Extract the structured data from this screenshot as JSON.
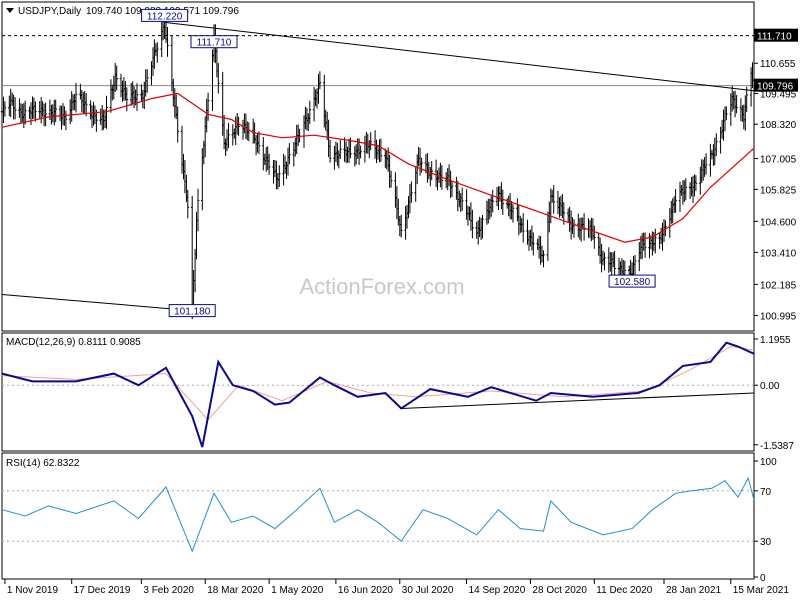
{
  "header": {
    "symbol": "USDJPY,Daily",
    "ohlc": "109.740 109.888 109.571 109.796"
  },
  "watermark": "ActionForex.com",
  "colors": {
    "candle": "#000000",
    "ma": "#e00000",
    "macd": "#0a0a8a",
    "signal": "#f0a0a0",
    "rsi": "#1e8fd8",
    "trendline": "#000000",
    "label_box": "#0a0a8a"
  },
  "x_axis": {
    "labels": [
      "1 Nov 2019",
      "17 Dec 2019",
      "3 Feb 2020",
      "18 Mar 2020",
      "1 May 2020",
      "16 Jun 2020",
      "30 Jul 2020",
      "14 Sep 2020",
      "28 Oct 2020",
      "11 Dec 2020",
      "28 Jan 2021",
      "15 Mar 2021"
    ]
  },
  "price_axis": {
    "ticks": [
      "110.655",
      "109.495",
      "108.320",
      "107.005",
      "105.825",
      "104.600",
      "103.410",
      "102.185",
      "100.995"
    ],
    "current": "109.796",
    "resistance": "111.710"
  },
  "annotations": [
    "112.220",
    "111.710",
    "101.180",
    "102.580"
  ],
  "macd_panel": {
    "title": "MACD(12,26,9) 0.8111 0.9085",
    "ticks": [
      "1.1955",
      "0.00",
      "-1.5387"
    ]
  },
  "rsi_panel": {
    "title": "RSI(14) 62.8322",
    "ticks": [
      "100",
      "70",
      "30",
      "0"
    ]
  },
  "chart_data": [
    {
      "type": "candlestick",
      "title": "USDJPY,Daily",
      "ylim": [
        100.4,
        113.0
      ],
      "x_range": [
        "2019-10-30",
        "2021-03-31"
      ],
      "price_path": [
        {
          "date": "2019-10-30",
          "value": 108.8
        },
        {
          "date": "2019-11-05",
          "value": 109.1
        },
        {
          "date": "2019-11-15",
          "value": 108.7
        },
        {
          "date": "2019-11-25",
          "value": 108.9
        },
        {
          "date": "2019-12-05",
          "value": 108.7
        },
        {
          "date": "2019-12-12",
          "value": 108.6
        },
        {
          "date": "2019-12-20",
          "value": 109.4
        },
        {
          "date": "2020-01-01",
          "value": 108.7
        },
        {
          "date": "2020-01-08",
          "value": 108.4
        },
        {
          "date": "2020-01-16",
          "value": 110.2
        },
        {
          "date": "2020-01-24",
          "value": 109.3
        },
        {
          "date": "2020-02-04",
          "value": 109.5
        },
        {
          "date": "2020-02-19",
          "value": 112.2
        },
        {
          "date": "2020-02-28",
          "value": 108.0
        },
        {
          "date": "2020-03-06",
          "value": 105.3
        },
        {
          "date": "2020-03-09",
          "value": 101.18
        },
        {
          "date": "2020-03-12",
          "value": 104.6
        },
        {
          "date": "2020-03-24",
          "value": 111.71
        },
        {
          "date": "2020-03-31",
          "value": 107.5
        },
        {
          "date": "2020-04-10",
          "value": 108.4
        },
        {
          "date": "2020-04-22",
          "value": 107.7
        },
        {
          "date": "2020-05-06",
          "value": 106.2
        },
        {
          "date": "2020-05-18",
          "value": 107.4
        },
        {
          "date": "2020-06-05",
          "value": 109.8
        },
        {
          "date": "2020-06-12",
          "value": 107.2
        },
        {
          "date": "2020-06-25",
          "value": 107.2
        },
        {
          "date": "2020-07-08",
          "value": 107.5
        },
        {
          "date": "2020-07-20",
          "value": 107.2
        },
        {
          "date": "2020-07-31",
          "value": 104.2
        },
        {
          "date": "2020-08-12",
          "value": 106.9
        },
        {
          "date": "2020-08-27",
          "value": 106.2
        },
        {
          "date": "2020-09-02",
          "value": 106.2
        },
        {
          "date": "2020-09-21",
          "value": 104.2
        },
        {
          "date": "2020-10-06",
          "value": 105.7
        },
        {
          "date": "2020-10-21",
          "value": 104.5
        },
        {
          "date": "2020-11-06",
          "value": 103.2
        },
        {
          "date": "2020-11-11",
          "value": 105.6
        },
        {
          "date": "2020-11-25",
          "value": 104.5
        },
        {
          "date": "2020-12-10",
          "value": 104.2
        },
        {
          "date": "2020-12-17",
          "value": 103.1
        },
        {
          "date": "2021-01-06",
          "value": 102.6
        },
        {
          "date": "2021-01-13",
          "value": 103.8
        },
        {
          "date": "2021-01-25",
          "value": 103.8
        },
        {
          "date": "2021-02-05",
          "value": 105.5
        },
        {
          "date": "2021-02-16",
          "value": 105.9
        },
        {
          "date": "2021-03-02",
          "value": 107.1
        },
        {
          "date": "2021-03-11",
          "value": 108.6
        },
        {
          "date": "2021-03-16",
          "value": 109.2
        },
        {
          "date": "2021-03-24",
          "value": 108.7
        },
        {
          "date": "2021-03-29",
          "value": 110.3
        },
        {
          "date": "2021-03-31",
          "value": 109.796
        }
      ],
      "moving_average": [
        {
          "date": "2019-10-30",
          "value": 108.2
        },
        {
          "date": "2019-12-01",
          "value": 108.6
        },
        {
          "date": "2020-01-10",
          "value": 108.8
        },
        {
          "date": "2020-02-10",
          "value": 109.3
        },
        {
          "date": "2020-02-28",
          "value": 109.5
        },
        {
          "date": "2020-03-20",
          "value": 108.7
        },
        {
          "date": "2020-04-05",
          "value": 108.5
        },
        {
          "date": "2020-04-20",
          "value": 108.0
        },
        {
          "date": "2020-05-10",
          "value": 107.8
        },
        {
          "date": "2020-06-01",
          "value": 107.9
        },
        {
          "date": "2020-06-25",
          "value": 107.7
        },
        {
          "date": "2020-07-15",
          "value": 107.5
        },
        {
          "date": "2020-08-05",
          "value": 106.8
        },
        {
          "date": "2020-09-01",
          "value": 106.2
        },
        {
          "date": "2020-10-01",
          "value": 105.6
        },
        {
          "date": "2020-11-01",
          "value": 105.0
        },
        {
          "date": "2020-12-01",
          "value": 104.4
        },
        {
          "date": "2021-01-01",
          "value": 103.8
        },
        {
          "date": "2021-01-20",
          "value": 104.0
        },
        {
          "date": "2021-02-10",
          "value": 104.7
        },
        {
          "date": "2021-03-01",
          "value": 105.9
        },
        {
          "date": "2021-03-31",
          "value": 107.4
        }
      ],
      "resistance_line": 111.71,
      "current_price_line": 109.796,
      "trendlines": [
        {
          "from": {
            "date": "2020-02-19",
            "value": 112.22
          },
          "to": {
            "date": "2021-03-31",
            "value": 109.6
          }
        },
        {
          "from": {
            "date": "2019-10-30",
            "value": 101.8
          },
          "to": {
            "date": "2020-03-09",
            "value": 101.18
          }
        }
      ]
    },
    {
      "type": "line",
      "title": "MACD(12,26,9) 0.8111 0.9085",
      "ylim": [
        -1.7,
        1.35
      ],
      "series": [
        {
          "name": "MACD",
          "values": [
            {
              "date": "2019-10-30",
              "value": 0.3
            },
            {
              "date": "2019-11-20",
              "value": 0.1
            },
            {
              "date": "2019-12-20",
              "value": 0.1
            },
            {
              "date": "2020-01-15",
              "value": 0.3
            },
            {
              "date": "2020-02-01",
              "value": 0.0
            },
            {
              "date": "2020-02-20",
              "value": 0.45
            },
            {
              "date": "2020-03-09",
              "value": -0.8
            },
            {
              "date": "2020-03-16",
              "value": -1.6
            },
            {
              "date": "2020-03-27",
              "value": 0.6
            },
            {
              "date": "2020-04-06",
              "value": 0.0
            },
            {
              "date": "2020-04-20",
              "value": -0.15
            },
            {
              "date": "2020-05-05",
              "value": -0.5
            },
            {
              "date": "2020-05-15",
              "value": -0.45
            },
            {
              "date": "2020-06-05",
              "value": 0.2
            },
            {
              "date": "2020-06-15",
              "value": 0.0
            },
            {
              "date": "2020-07-01",
              "value": -0.3
            },
            {
              "date": "2020-07-20",
              "value": -0.2
            },
            {
              "date": "2020-07-31",
              "value": -0.6
            },
            {
              "date": "2020-08-20",
              "value": -0.1
            },
            {
              "date": "2020-09-15",
              "value": -0.3
            },
            {
              "date": "2020-10-01",
              "value": -0.05
            },
            {
              "date": "2020-11-01",
              "value": -0.4
            },
            {
              "date": "2020-11-11",
              "value": -0.2
            },
            {
              "date": "2020-12-10",
              "value": -0.3
            },
            {
              "date": "2021-01-10",
              "value": -0.2
            },
            {
              "date": "2021-01-25",
              "value": 0.0
            },
            {
              "date": "2021-02-10",
              "value": 0.5
            },
            {
              "date": "2021-03-01",
              "value": 0.6
            },
            {
              "date": "2021-03-12",
              "value": 1.1
            },
            {
              "date": "2021-03-20",
              "value": 1.0
            },
            {
              "date": "2021-03-31",
              "value": 0.8111
            }
          ]
        },
        {
          "name": "Signal",
          "values": [
            {
              "date": "2019-10-30",
              "value": 0.25
            },
            {
              "date": "2019-12-20",
              "value": 0.15
            },
            {
              "date": "2020-02-20",
              "value": 0.3
            },
            {
              "date": "2020-03-20",
              "value": -0.9
            },
            {
              "date": "2020-04-10",
              "value": 0.0
            },
            {
              "date": "2020-05-10",
              "value": -0.4
            },
            {
              "date": "2020-06-10",
              "value": 0.1
            },
            {
              "date": "2020-07-10",
              "value": -0.2
            },
            {
              "date": "2020-08-10",
              "value": -0.3
            },
            {
              "date": "2020-10-01",
              "value": -0.15
            },
            {
              "date": "2020-11-20",
              "value": -0.3
            },
            {
              "date": "2021-01-15",
              "value": -0.15
            },
            {
              "date": "2021-02-15",
              "value": 0.4
            },
            {
              "date": "2021-03-15",
              "value": 1.0
            },
            {
              "date": "2021-03-31",
              "value": 0.9085
            }
          ]
        }
      ],
      "trendline": {
        "from": {
          "date": "2020-07-31",
          "value": -0.6
        },
        "to": {
          "date": "2021-03-31",
          "value": -0.2
        }
      }
    },
    {
      "type": "line",
      "title": "RSI(14) 62.8322",
      "ylim": [
        0,
        100
      ],
      "levels": [
        70,
        30
      ],
      "series": [
        {
          "name": "RSI",
          "values": [
            {
              "date": "2019-10-30",
              "value": 55
            },
            {
              "date": "2019-11-15",
              "value": 50
            },
            {
              "date": "2019-12-01",
              "value": 58
            },
            {
              "date": "2019-12-20",
              "value": 52
            },
            {
              "date": "2020-01-15",
              "value": 62
            },
            {
              "date": "2020-02-01",
              "value": 48
            },
            {
              "date": "2020-02-20",
              "value": 73
            },
            {
              "date": "2020-03-09",
              "value": 22
            },
            {
              "date": "2020-03-24",
              "value": 68
            },
            {
              "date": "2020-04-05",
              "value": 45
            },
            {
              "date": "2020-04-20",
              "value": 50
            },
            {
              "date": "2020-05-05",
              "value": 40
            },
            {
              "date": "2020-05-20",
              "value": 55
            },
            {
              "date": "2020-06-05",
              "value": 72
            },
            {
              "date": "2020-06-15",
              "value": 45
            },
            {
              "date": "2020-07-01",
              "value": 55
            },
            {
              "date": "2020-07-15",
              "value": 45
            },
            {
              "date": "2020-07-31",
              "value": 30
            },
            {
              "date": "2020-08-15",
              "value": 55
            },
            {
              "date": "2020-09-01",
              "value": 48
            },
            {
              "date": "2020-09-21",
              "value": 35
            },
            {
              "date": "2020-10-06",
              "value": 55
            },
            {
              "date": "2020-10-21",
              "value": 40
            },
            {
              "date": "2020-11-06",
              "value": 38
            },
            {
              "date": "2020-11-11",
              "value": 62
            },
            {
              "date": "2020-11-25",
              "value": 45
            },
            {
              "date": "2020-12-17",
              "value": 35
            },
            {
              "date": "2021-01-06",
              "value": 40
            },
            {
              "date": "2021-01-20",
              "value": 55
            },
            {
              "date": "2021-02-05",
              "value": 68
            },
            {
              "date": "2021-02-16",
              "value": 70
            },
            {
              "date": "2021-03-02",
              "value": 72
            },
            {
              "date": "2021-03-11",
              "value": 78
            },
            {
              "date": "2021-03-20",
              "value": 65
            },
            {
              "date": "2021-03-27",
              "value": 80
            },
            {
              "date": "2021-03-31",
              "value": 62.8322
            }
          ]
        }
      ]
    }
  ]
}
